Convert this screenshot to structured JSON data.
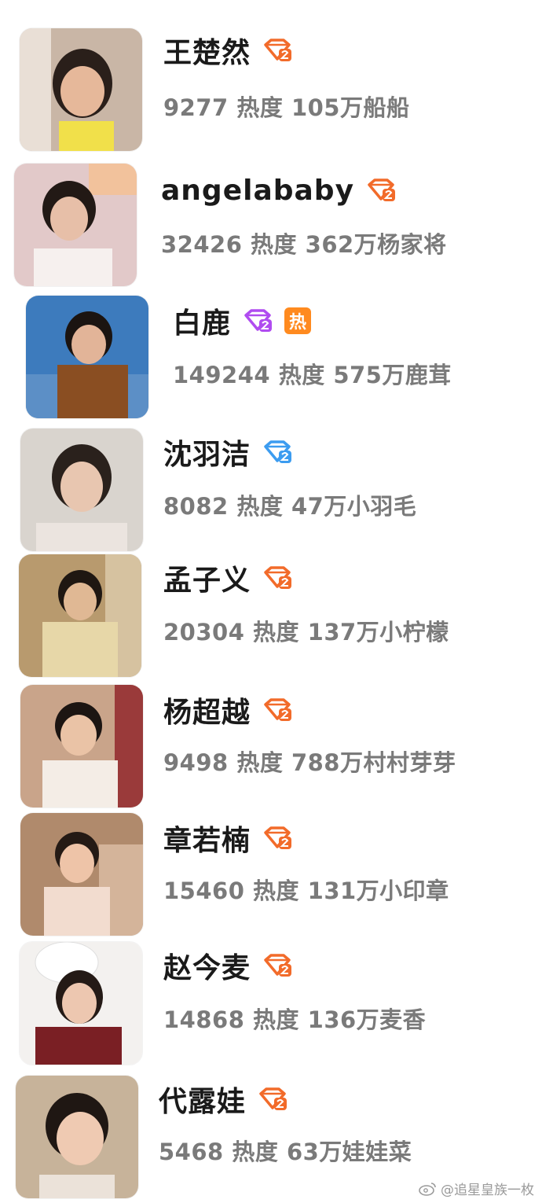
{
  "users": [
    {
      "name": "王楚然",
      "heat": "9277",
      "heat_label": "热度",
      "fans": "105万船船",
      "badge": "orange",
      "hot": false
    },
    {
      "name": "angelababy",
      "heat": "32426",
      "heat_label": "热度",
      "fans": "362万杨家将",
      "badge": "orange",
      "hot": false
    },
    {
      "name": "白鹿",
      "heat": "149244",
      "heat_label": "热度",
      "fans": "575万鹿茸",
      "badge": "purple",
      "hot": true,
      "hot_label": "热"
    },
    {
      "name": "沈羽洁",
      "heat": "8082",
      "heat_label": "热度",
      "fans": "47万小羽毛",
      "badge": "blue",
      "hot": false
    },
    {
      "name": "孟子义",
      "heat": "20304",
      "heat_label": "热度",
      "fans": "137万小柠檬",
      "badge": "orange",
      "hot": false
    },
    {
      "name": "杨超越",
      "heat": "9498",
      "heat_label": "热度",
      "fans": "788万村村芽芽",
      "badge": "orange",
      "hot": false
    },
    {
      "name": "章若楠",
      "heat": "15460",
      "heat_label": "热度",
      "fans": "131万小印章",
      "badge": "orange",
      "hot": false
    },
    {
      "name": "赵今麦",
      "heat": "14868",
      "heat_label": "热度",
      "fans": "136万麦香",
      "badge": "orange",
      "hot": false
    },
    {
      "name": "代露娃",
      "heat": "5468",
      "heat_label": "热度",
      "fans": "63万娃娃菜",
      "badge": "orange",
      "hot": false
    }
  ],
  "badge_colors": {
    "orange": "#f26b2a",
    "purple": "#b04cf0",
    "blue": "#3c9cf0"
  },
  "watermark": "@追星皇族一枚"
}
